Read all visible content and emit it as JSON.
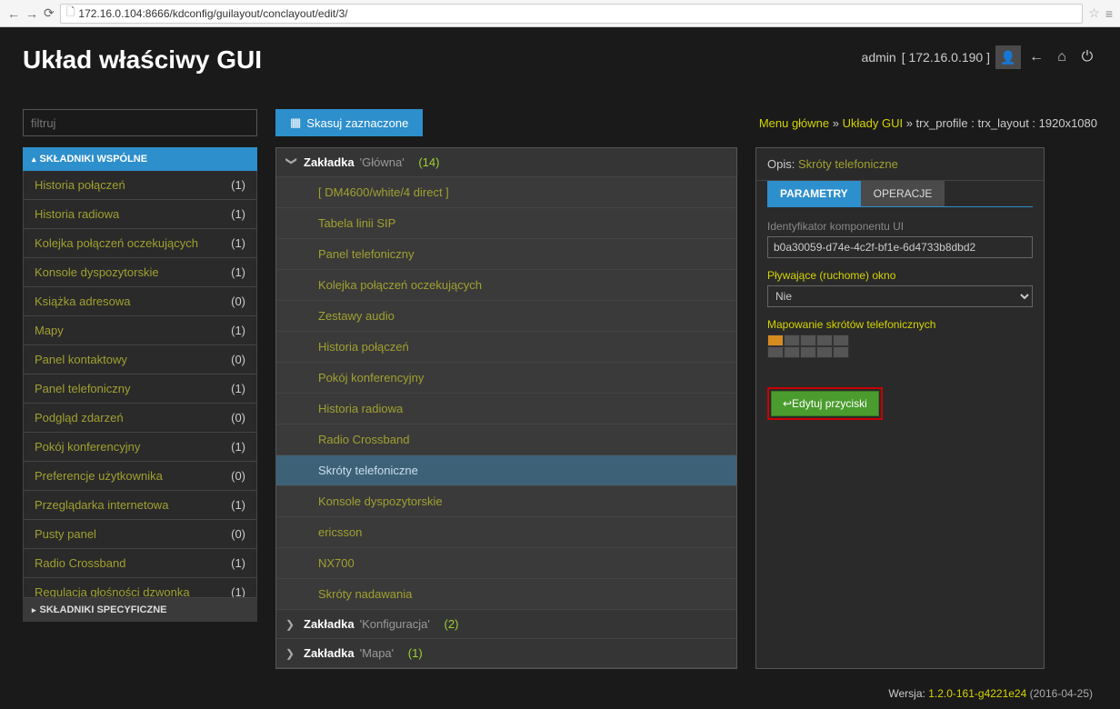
{
  "browser": {
    "url": "172.16.0.104:8666/kdconfig/guilayout/conclayout/edit/3/"
  },
  "header": {
    "title": "Układ właściwy GUI",
    "user": "admin",
    "ip": "[ 172.16.0.190 ]"
  },
  "toolbar": {
    "filter_placeholder": "filtruj",
    "delete_label": "Skasuj zaznaczone"
  },
  "breadcrumb": {
    "items": [
      "Menu główne",
      "Układy GUI",
      "trx_profile : trx_layout : 1920x1080"
    ]
  },
  "sidebar": {
    "section_common": "SKŁADNIKI WSPÓLNE",
    "section_specific": "SKŁADNIKI SPECYFICZNE",
    "items": [
      {
        "label": "Historia połączeń",
        "count": "(1)"
      },
      {
        "label": "Historia radiowa",
        "count": "(1)"
      },
      {
        "label": "Kolejka połączeń oczekujących",
        "count": "(1)"
      },
      {
        "label": "Konsole dyspozytorskie",
        "count": "(1)"
      },
      {
        "label": "Książka adresowa",
        "count": "(0)"
      },
      {
        "label": "Mapy",
        "count": "(1)"
      },
      {
        "label": "Panel kontaktowy",
        "count": "(0)"
      },
      {
        "label": "Panel telefoniczny",
        "count": "(1)"
      },
      {
        "label": "Podgląd zdarzeń",
        "count": "(0)"
      },
      {
        "label": "Pokój konferencyjny",
        "count": "(1)"
      },
      {
        "label": "Preferencje użytkownika",
        "count": "(0)"
      },
      {
        "label": "Przeglądarka internetowa",
        "count": "(1)"
      },
      {
        "label": "Pusty panel",
        "count": "(0)"
      },
      {
        "label": "Radio Crossband",
        "count": "(1)"
      },
      {
        "label": "Regulacja głośności dzwonka",
        "count": "(1)"
      }
    ]
  },
  "tabs": {
    "tab_prefix": "Zakładka",
    "groups": [
      {
        "name": "'Główna'",
        "count": "(14)",
        "expanded": true,
        "items": [
          "[ DM4600/white/4 direct ]",
          "Tabela linii SIP",
          "Panel telefoniczny",
          "Kolejka połączeń oczekujących",
          "Zestawy audio",
          "Historia połączeń",
          "Pokój konferencyjny",
          "Historia radiowa",
          "Radio Crossband",
          "Skróty telefoniczne",
          "Konsole dyspozytorskie",
          "ericsson",
          "NX700",
          "Skróty nadawania"
        ],
        "selected": 9
      },
      {
        "name": "'Konfiguracja'",
        "count": "(2)",
        "expanded": false
      },
      {
        "name": "'Mapa'",
        "count": "(1)",
        "expanded": false
      }
    ]
  },
  "details": {
    "opis_label": "Opis:",
    "opis_value": "Skróty telefoniczne",
    "tabs": {
      "params": "PARAMETRY",
      "ops": "OPERACJE"
    },
    "fields": {
      "id_label": "Identyfikator komponentu UI",
      "id_value": "b0a30059-d74e-4c2f-bf1e-6d4733b8dbd2",
      "float_label": "Pływające (ruchome) okno",
      "float_value": "Nie",
      "mapping_label": "Mapowanie skrótów telefonicznych",
      "edit_label": "↩Edytuj przyciski"
    }
  },
  "footer": {
    "label": "Wersja:",
    "version": "1.2.0-161-g4221e24",
    "date": "(2016-04-25)"
  }
}
